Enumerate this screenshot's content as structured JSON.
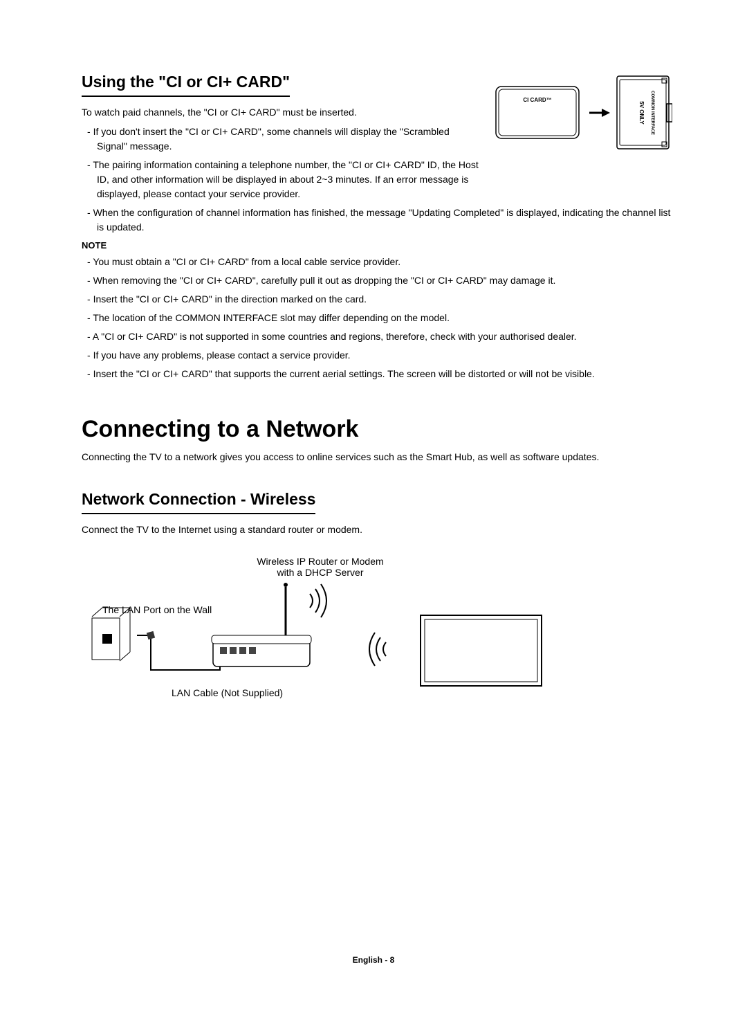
{
  "section1": {
    "title": "Using the \"CI or CI+ CARD\"",
    "intro": "To watch paid channels, the \"CI or CI+ CARD\" must be inserted.",
    "bullets_top": [
      "If you don't insert the \"CI or CI+ CARD\", some channels will display the \"Scrambled Signal\" message.",
      "The pairing information containing a telephone number, the \"CI or CI+ CARD\" ID, the Host ID, and other information will be displayed in about 2~3 minutes. If an error message is displayed, please contact your service provider."
    ],
    "bullets_below": [
      "When the configuration of channel information has finished, the message \"Updating Completed\" is displayed, indicating the channel list is updated."
    ],
    "note_heading": "NOTE",
    "note_bullets": [
      "You must obtain a \"CI or CI+ CARD\" from a local cable service provider.",
      "When removing the \"CI or CI+ CARD\", carefully pull it out as dropping the \"CI or CI+ CARD\" may damage it.",
      "Insert the \"CI or CI+ CARD\" in the direction marked on the card.",
      "The location of the COMMON INTERFACE slot may differ depending on the model.",
      "A \"CI or CI+ CARD\" is not supported in some countries and regions, therefore, check with your authorised dealer.",
      "If you have any problems, please contact a service provider.",
      "Insert the \"CI or CI+ CARD\" that supports the current aerial settings. The screen will be distorted or will not be visible."
    ],
    "ci_diagram": {
      "card_label": "CI CARD™",
      "slot_label_1": "5V ONLY",
      "slot_label_2": "COMMON INTERFACE"
    }
  },
  "section2": {
    "title": "Connecting to a Network",
    "intro": "Connecting the TV to a network gives you access to online services such as the Smart Hub, as well as software updates."
  },
  "section3": {
    "title": "Network Connection - Wireless",
    "intro": "Connect the TV to the Internet using a standard router or modem.",
    "diagram": {
      "router_label": "Wireless IP Router or Modem with a DHCP Server",
      "lan_port_label": "The LAN Port on the Wall",
      "lan_cable_label": "LAN Cable (Not Supplied)"
    }
  },
  "footer": "English - 8"
}
